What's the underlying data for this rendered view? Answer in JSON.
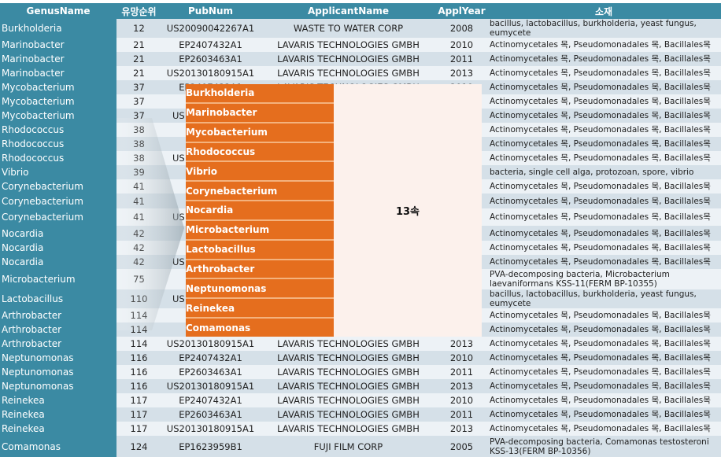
{
  "headers": [
    "GenusName",
    "유망순위",
    "PubNum",
    "ApplicantName",
    "ApplYear",
    "소재"
  ],
  "rows": [
    [
      "Burkholderia",
      "12",
      "US20090042267A1",
      "WASTE TO WATER CORP",
      "2008",
      "bacillus, lactobacillus, burkholderia, yeast fungus, eumycete"
    ],
    [
      "Marinobacter",
      "21",
      "EP2407432A1",
      "LAVARIS TECHNOLOGIES GMBH",
      "2010",
      "Actinomycetales 목, Pseudomonadales 목, Bacillales목"
    ],
    [
      "Marinobacter",
      "21",
      "EP2603463A1",
      "LAVARIS TECHNOLOGIES GMBH",
      "2011",
      "Actinomycetales 목, Pseudomonadales 목, Bacillales목"
    ],
    [
      "Marinobacter",
      "21",
      "US20130180915A1",
      "LAVARIS TECHNOLOGIES GMBH",
      "2013",
      "Actinomycetales 목, Pseudomonadales 목, Bacillales목"
    ],
    [
      "Mycobacterium",
      "37",
      "EP2407432A1",
      "LAVARIS TECHNOLOGIES GMBH",
      "2010",
      "Actinomycetales 목, Pseudomonadales 목, Bacillales목"
    ],
    [
      "Mycobacterium",
      "37",
      "",
      "",
      "",
      "Actinomycetales 목, Pseudomonadales 목, Bacillales목"
    ],
    [
      "Mycobacterium",
      "37",
      "US",
      "",
      "",
      "Actinomycetales 목, Pseudomonadales 목, Bacillales목"
    ],
    [
      "Rhodococcus",
      "38",
      "",
      "",
      "",
      "Actinomycetales 목, Pseudomonadales 목, Bacillales목"
    ],
    [
      "Rhodococcus",
      "38",
      "",
      "",
      "",
      "Actinomycetales 목, Pseudomonadales 목, Bacillales목"
    ],
    [
      "Rhodococcus",
      "38",
      "US",
      "",
      "",
      "Actinomycetales 목, Pseudomonadales 목, Bacillales목"
    ],
    [
      "Vibrio",
      "39",
      "",
      "",
      "",
      "bacteria, single cell alga, protozoan, spore, vibrio"
    ],
    [
      "Corynebacterium",
      "41",
      "",
      "",
      "",
      "Actinomycetales 목, Pseudomonadales 목, Bacillales목"
    ],
    [
      "Corynebacterium",
      "41",
      "",
      "",
      "",
      "Actinomycetales 목, Pseudomonadales 목, Bacillales목"
    ],
    [
      "Corynebacterium",
      "41",
      "US",
      "",
      "",
      "Actinomycetales 목, Pseudomonadales 목, Bacillales목"
    ],
    [
      "Nocardia",
      "42",
      "",
      "",
      "",
      "Actinomycetales 목, Pseudomonadales 목, Bacillales목"
    ],
    [
      "Nocardia",
      "42",
      "",
      "",
      "",
      "Actinomycetales 목, Pseudomonadales 목, Bacillales목"
    ],
    [
      "Nocardia",
      "42",
      "US",
      "",
      "",
      "Actinomycetales 목, Pseudomonadales 목, Bacillales목"
    ],
    [
      "Microbacterium",
      "75",
      "",
      "",
      "",
      "PVA-decomposing bacteria, Microbacterium laevaniformans KSS-11(FERM BP-10355)"
    ],
    [
      "Lactobacillus",
      "110",
      "US",
      "",
      "",
      "bacillus, lactobacillus, burkholderia, yeast fungus, eumycete"
    ],
    [
      "Arthrobacter",
      "114",
      "",
      "",
      "",
      "Actinomycetales 목, Pseudomonadales 목, Bacillales목"
    ],
    [
      "Arthrobacter",
      "114",
      "",
      "",
      "",
      "Actinomycetales 목, Pseudomonadales 목, Bacillales목"
    ],
    [
      "Arthrobacter",
      "114",
      "US20130180915A1",
      "LAVARIS TECHNOLOGIES GMBH",
      "2013",
      "Actinomycetales 목, Pseudomonadales 목, Bacillales목"
    ],
    [
      "Neptunomonas",
      "116",
      "EP2407432A1",
      "LAVARIS TECHNOLOGIES GMBH",
      "2010",
      "Actinomycetales 목, Pseudomonadales 목, Bacillales목"
    ],
    [
      "Neptunomonas",
      "116",
      "EP2603463A1",
      "LAVARIS TECHNOLOGIES GMBH",
      "2011",
      "Actinomycetales 목, Pseudomonadales 목, Bacillales목"
    ],
    [
      "Neptunomonas",
      "116",
      "US20130180915A1",
      "LAVARIS TECHNOLOGIES GMBH",
      "2013",
      "Actinomycetales 목, Pseudomonadales 목, Bacillales목"
    ],
    [
      "Reinekea",
      "117",
      "EP2407432A1",
      "LAVARIS TECHNOLOGIES GMBH",
      "2010",
      "Actinomycetales 목, Pseudomonadales 목, Bacillales목"
    ],
    [
      "Reinekea",
      "117",
      "EP2603463A1",
      "LAVARIS TECHNOLOGIES GMBH",
      "2011",
      "Actinomycetales 목, Pseudomonadales 목, Bacillales목"
    ],
    [
      "Reinekea",
      "117",
      "US20130180915A1",
      "LAVARIS TECHNOLOGIES GMBH",
      "2013",
      "Actinomycetales 목, Pseudomonadales 목, Bacillales목"
    ],
    [
      "Comamonas",
      "124",
      "EP1623959B1",
      "FUJI FILM CORP",
      "2005",
      "PVA-decomposing bacteria, Comamonas testosteroni KSS-13(FERM BP-10356)"
    ]
  ],
  "overlay": {
    "genera": [
      "Burkholderia",
      "Marinobacter",
      "Mycobacterium",
      "Rhodococcus",
      "Vibrio",
      "Corynebacterium",
      "Nocardia",
      "Microbacterium",
      "Lactobacillus",
      "Arthrobacter",
      "Neptunomonas",
      "Reinekea",
      "Comamonas"
    ],
    "summary": "13속"
  },
  "colors": {
    "header": "#3b8aa3",
    "overlay_list": "#e56e1e",
    "overlay_box": "#fcf1ec"
  }
}
